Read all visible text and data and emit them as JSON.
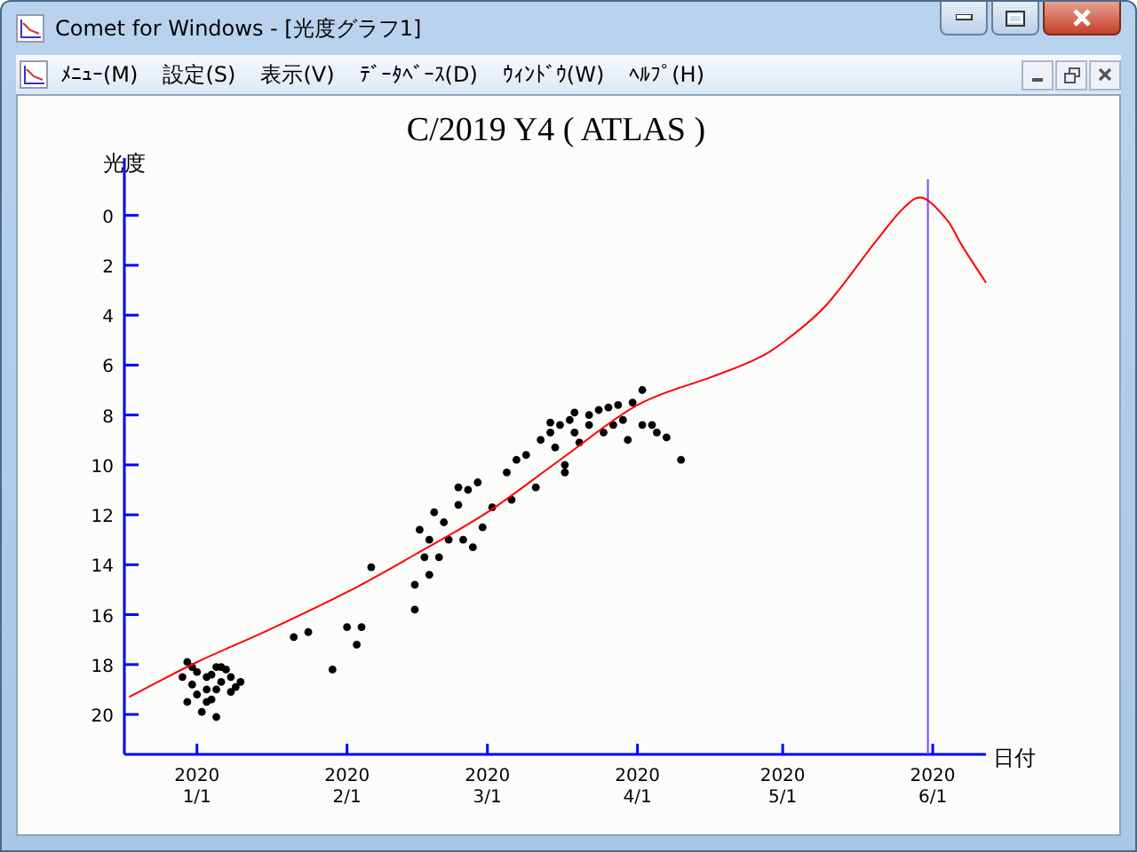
{
  "window": {
    "title": "Comet for Windows - [光度グラフ1]"
  },
  "menu": [
    "ﾒﾆｭｰ(M)",
    "設定(S)",
    "表示(V)",
    "ﾃﾞｰﾀﾍﾞｰｽ(D)",
    "ｳｨﾝﾄﾞｳ(W)",
    "ﾍﾙﾌﾟ(H)"
  ],
  "graph": {
    "chart_data": {
      "type": "scatter",
      "title": "C/2019 Y4 ( ATLAS )",
      "xlabel": "日付",
      "ylabel": "光度",
      "xlim": [
        "2019-12-17",
        "2020-06-12"
      ],
      "ylim": [
        21.6,
        -2.3
      ],
      "xticks": [
        {
          "value": "2020-01-01",
          "label": "2020\n1/1"
        },
        {
          "value": "2020-02-01",
          "label": "2020\n2/1"
        },
        {
          "value": "2020-03-01",
          "label": "2020\n3/1"
        },
        {
          "value": "2020-04-01",
          "label": "2020\n4/1"
        },
        {
          "value": "2020-05-01",
          "label": "2020\n5/1"
        },
        {
          "value": "2020-06-01",
          "label": "2020\n6/1"
        }
      ],
      "yticks": [
        0,
        2,
        4,
        6,
        8,
        10,
        12,
        14,
        16,
        18,
        20
      ],
      "series": [
        {
          "type": "scatter",
          "color": "#000000",
          "x": [
            "2019-12-29",
            "2019-12-30",
            "2019-12-30",
            "2019-12-31",
            "2020-01-01",
            "2020-01-02",
            "2020-01-03",
            "2020-01-03",
            "2020-01-04",
            "2020-01-05",
            "2020-01-05",
            "2020-01-06",
            "2020-01-07",
            "2020-01-08",
            "2020-01-08",
            "2020-01-09",
            "2020-01-10",
            "2020-01-01",
            "2020-01-03",
            "2020-01-05",
            "2019-12-31",
            "2020-01-04",
            "2020-01-06",
            "2020-01-21",
            "2020-01-24",
            "2020-01-29",
            "2020-02-01",
            "2020-02-03",
            "2020-02-04",
            "2020-02-06",
            "2020-02-15",
            "2020-02-15",
            "2020-02-16",
            "2020-02-17",
            "2020-02-18",
            "2020-02-18",
            "2020-02-19",
            "2020-02-20",
            "2020-02-21",
            "2020-02-22",
            "2020-02-24",
            "2020-02-24",
            "2020-02-25",
            "2020-02-26",
            "2020-02-27",
            "2020-02-28",
            "2020-02-29",
            "2020-03-02",
            "2020-03-05",
            "2020-03-06",
            "2020-03-07",
            "2020-03-09",
            "2020-03-11",
            "2020-03-12",
            "2020-03-14",
            "2020-03-14",
            "2020-03-15",
            "2020-03-16",
            "2020-03-17",
            "2020-03-17",
            "2020-03-18",
            "2020-03-19",
            "2020-03-19",
            "2020-03-20",
            "2020-03-22",
            "2020-03-22",
            "2020-03-24",
            "2020-03-25",
            "2020-03-26",
            "2020-03-27",
            "2020-03-28",
            "2020-03-30",
            "2020-03-31",
            "2020-04-02",
            "2020-04-02",
            "2020-04-04",
            "2020-04-05",
            "2020-04-07",
            "2020-04-10",
            "2020-03-29"
          ],
          "values": [
            18.5,
            17.9,
            19.5,
            18.8,
            18.3,
            19.9,
            19,
            18.5,
            19.4,
            18.1,
            19,
            18.7,
            18.2,
            19.1,
            18.5,
            18.9,
            18.7,
            19.2,
            19.5,
            20.1,
            18.1,
            18.4,
            18.1,
            16.9,
            16.7,
            18.2,
            16.5,
            17.2,
            16.5,
            14.1,
            15.8,
            14.8,
            12.6,
            13.7,
            13,
            14.4,
            11.9,
            13.7,
            12.3,
            13,
            11.6,
            10.9,
            13,
            11,
            13.3,
            10.7,
            12.5,
            11.7,
            10.3,
            11.4,
            9.8,
            9.6,
            10.9,
            9,
            8.7,
            8.3,
            9.3,
            8.4,
            10.3,
            10,
            8.2,
            8.7,
            7.9,
            9.1,
            8,
            8.4,
            7.8,
            8.7,
            7.7,
            8.4,
            7.6,
            9,
            7.5,
            8.4,
            7,
            8.4,
            8.7,
            8.9,
            9.8,
            8.2
          ]
        },
        {
          "type": "line",
          "color": "#ff0000",
          "x": [
            "2019-12-18",
            "2020-01-01",
            "2020-01-16",
            "2020-02-01",
            "2020-02-15",
            "2020-03-01",
            "2020-03-16",
            "2020-04-01",
            "2020-04-16",
            "2020-04-25",
            "2020-05-01",
            "2020-05-10",
            "2020-05-20",
            "2020-05-26",
            "2020-05-30",
            "2020-06-04",
            "2020-06-07",
            "2020-06-12"
          ],
          "values": [
            19.3,
            17.9,
            16.6,
            15.1,
            13.6,
            11.9,
            9.8,
            7.6,
            6.5,
            5.8,
            5.1,
            3.6,
            1.1,
            -0.3,
            -0.7,
            0.2,
            1.2,
            2.7
          ]
        }
      ],
      "ref_lines": [
        {
          "axis": "x",
          "value": "2020-05-31"
        }
      ]
    }
  }
}
